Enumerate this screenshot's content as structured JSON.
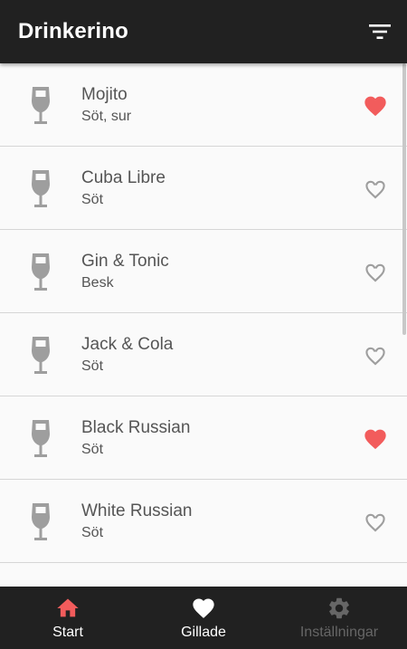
{
  "app_bar": {
    "title": "Drinkerino",
    "filter_icon": "filter-list-icon"
  },
  "drinks": [
    {
      "name": "Mojito",
      "taste": "Söt, sur",
      "favorite": true
    },
    {
      "name": "Cuba Libre",
      "taste": "Söt",
      "favorite": false
    },
    {
      "name": "Gin & Tonic",
      "taste": "Besk",
      "favorite": false
    },
    {
      "name": "Jack & Cola",
      "taste": "Söt",
      "favorite": false
    },
    {
      "name": "Black Russian",
      "taste": "Söt",
      "favorite": true
    },
    {
      "name": "White Russian",
      "taste": "Söt",
      "favorite": false
    },
    {
      "name": "",
      "taste": "",
      "favorite": false
    }
  ],
  "bottom_nav": {
    "items": [
      {
        "label": "Start",
        "icon": "home-icon",
        "active": true
      },
      {
        "label": "Gillade",
        "icon": "heart-icon",
        "active": false
      },
      {
        "label": "Inställningar",
        "icon": "gear-icon",
        "active": false,
        "disabled": true
      }
    ]
  },
  "colors": {
    "app_bar": "#212121",
    "accent": "#f25c5c",
    "icon_gray": "#9e9e9e",
    "text": "#555555",
    "nav_disabled": "#666666"
  }
}
